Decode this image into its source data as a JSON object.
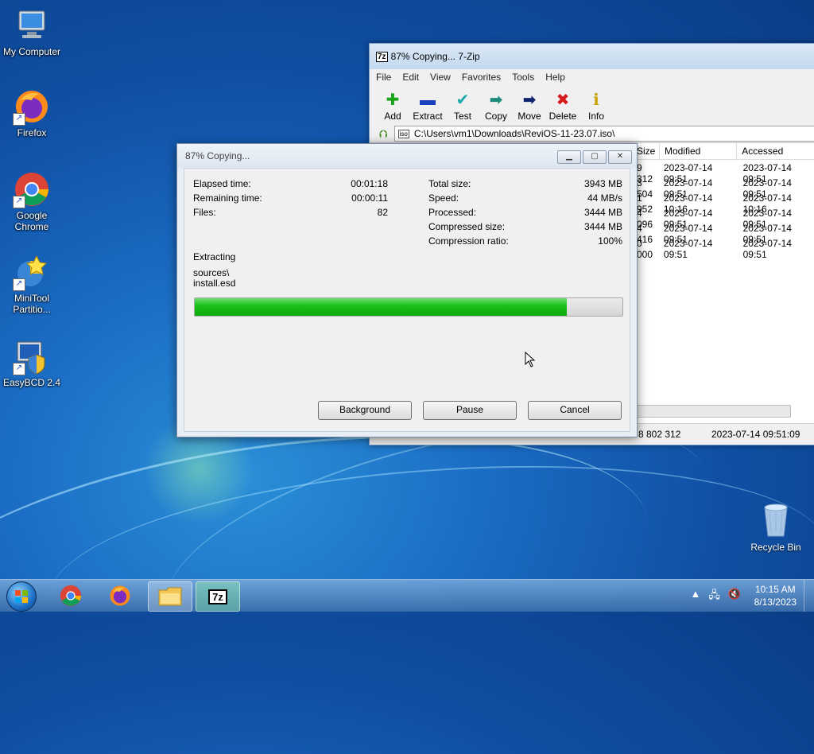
{
  "desktop": {
    "icons": [
      {
        "label": "My Computer"
      },
      {
        "label": "Firefox"
      },
      {
        "label": "Google Chrome"
      },
      {
        "label": "MiniTool Partitio..."
      },
      {
        "label": "EasyBCD 2.4"
      }
    ],
    "recycle_bin": "Recycle Bin"
  },
  "zip_window": {
    "title": "87% Copying... 7-Zip",
    "logo": "7z",
    "menu": [
      "File",
      "Edit",
      "View",
      "Favorites",
      "Tools",
      "Help"
    ],
    "toolbar": [
      {
        "label": "Add",
        "icon": "plus-icon",
        "color": "#1aa31a"
      },
      {
        "label": "Extract",
        "icon": "minus-icon",
        "color": "#1c3fbf"
      },
      {
        "label": "Test",
        "icon": "check-icon",
        "color": "#19a7a7"
      },
      {
        "label": "Copy",
        "icon": "arrow-right-icon",
        "color": "#1a8a7a"
      },
      {
        "label": "Move",
        "icon": "arrow-right-icon",
        "color": "#10246e"
      },
      {
        "label": "Delete",
        "icon": "x-icon",
        "color": "#d61a1a"
      },
      {
        "label": "Info",
        "icon": "info-icon",
        "color": "#c9a300"
      }
    ],
    "address": "C:\\Users\\vm1\\Downloads\\ReviOS-11-23.07.iso\\",
    "columns": [
      "Size",
      "Modified",
      "Accessed"
    ],
    "rows": [
      {
        "size": "9 312",
        "modified": "2023-07-14 09:51",
        "accessed": "2023-07-14 09:51"
      },
      {
        "size": "3 504",
        "modified": "2023-07-14 09:51",
        "accessed": "2023-07-14 09:51"
      },
      {
        "size": "1 952",
        "modified": "2023-07-14 10:16",
        "accessed": "2023-07-14 10:16"
      },
      {
        "size": "4 096",
        "modified": "2023-07-14 09:51",
        "accessed": "2023-07-14 09:51"
      },
      {
        "size": "4 416",
        "modified": "2023-07-14 09:51",
        "accessed": "2023-07-14 09:51"
      },
      {
        "size": "0 000",
        "modified": "2023-07-14 09:51",
        "accessed": "2023-07-14 09:51"
      }
    ],
    "status": {
      "size": "8 802 312",
      "date": "2023-07-14 09:51:09"
    }
  },
  "dialog": {
    "title": "87% Copying...",
    "elapsed_label": "Elapsed time:",
    "elapsed_value": "00:01:18",
    "remaining_label": "Remaining time:",
    "remaining_value": "00:00:11",
    "files_label": "Files:",
    "files_value": "82",
    "total_label": "Total size:",
    "total_value": "3943 MB",
    "speed_label": "Speed:",
    "speed_value": "44 MB/s",
    "processed_label": "Processed:",
    "processed_value": "3444 MB",
    "compressed_label": "Compressed size:",
    "compressed_value": "3444 MB",
    "ratio_label": "Compression ratio:",
    "ratio_value": "100%",
    "action": "Extracting",
    "path_line1": "sources\\",
    "path_line2": "install.esd",
    "progress": 0.87,
    "buttons": {
      "background": "Background",
      "pause": "Pause",
      "cancel": "Cancel"
    }
  },
  "taskbar": {
    "time": "10:15 AM",
    "date": "8/13/2023",
    "active_app": "7z"
  }
}
